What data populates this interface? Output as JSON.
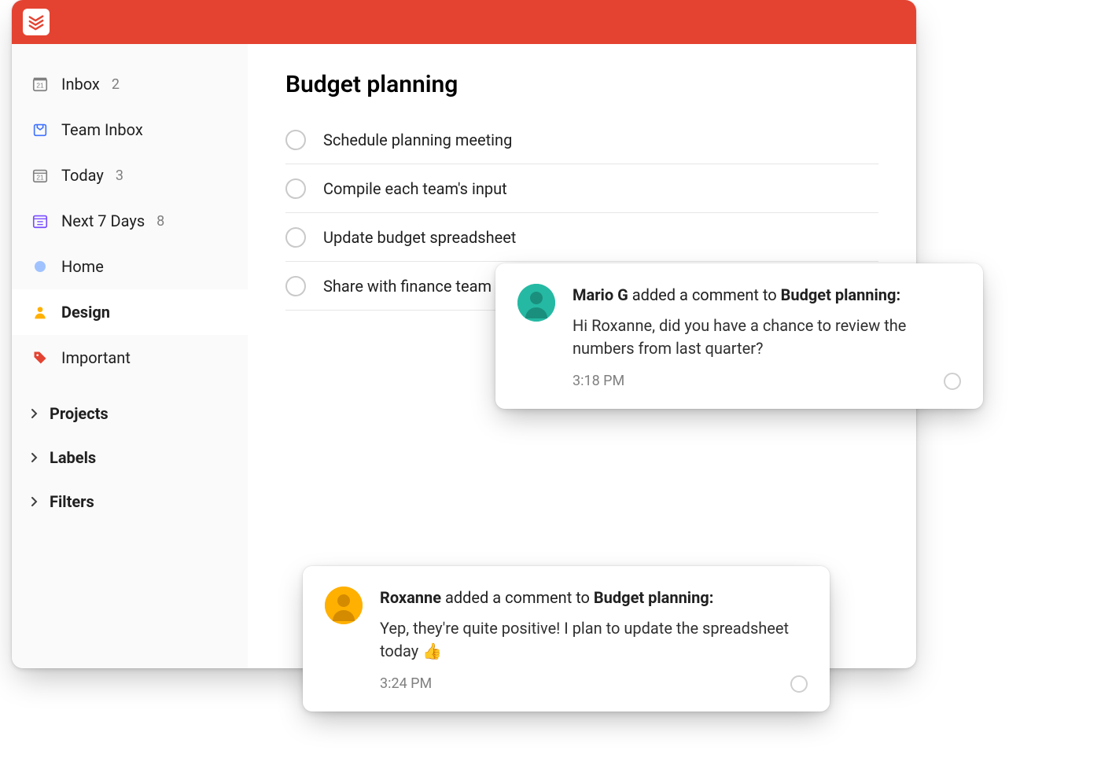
{
  "sidebar": {
    "inbox": {
      "label": "Inbox",
      "count": "2"
    },
    "team_inbox": {
      "label": "Team Inbox"
    },
    "today": {
      "label": "Today",
      "count": "3"
    },
    "next7": {
      "label": "Next 7 Days",
      "count": "8"
    },
    "projects": [
      {
        "label": "Home"
      },
      {
        "label": "Design"
      },
      {
        "label": "Important"
      }
    ],
    "sections": {
      "projects": "Projects",
      "labels": "Labels",
      "filters": "Filters"
    }
  },
  "main": {
    "title": "Budget planning",
    "tasks": [
      {
        "title": "Schedule planning meeting"
      },
      {
        "title": "Compile each team's input"
      },
      {
        "title": "Update budget spreadsheet"
      },
      {
        "title": "Share with finance team"
      }
    ]
  },
  "notifications": [
    {
      "user": "Mario G",
      "action": "added a comment to",
      "target": "Budget planning:",
      "message": "Hi Roxanne, did you have a chance to review the numbers from last quarter?",
      "time": "3:18 PM"
    },
    {
      "user": "Roxanne",
      "action": "added a comment to",
      "target": "Budget planning:",
      "message": "Yep, they're quite positive! I plan to update the spreadsheet today 👍",
      "time": "3:24 PM"
    }
  ]
}
